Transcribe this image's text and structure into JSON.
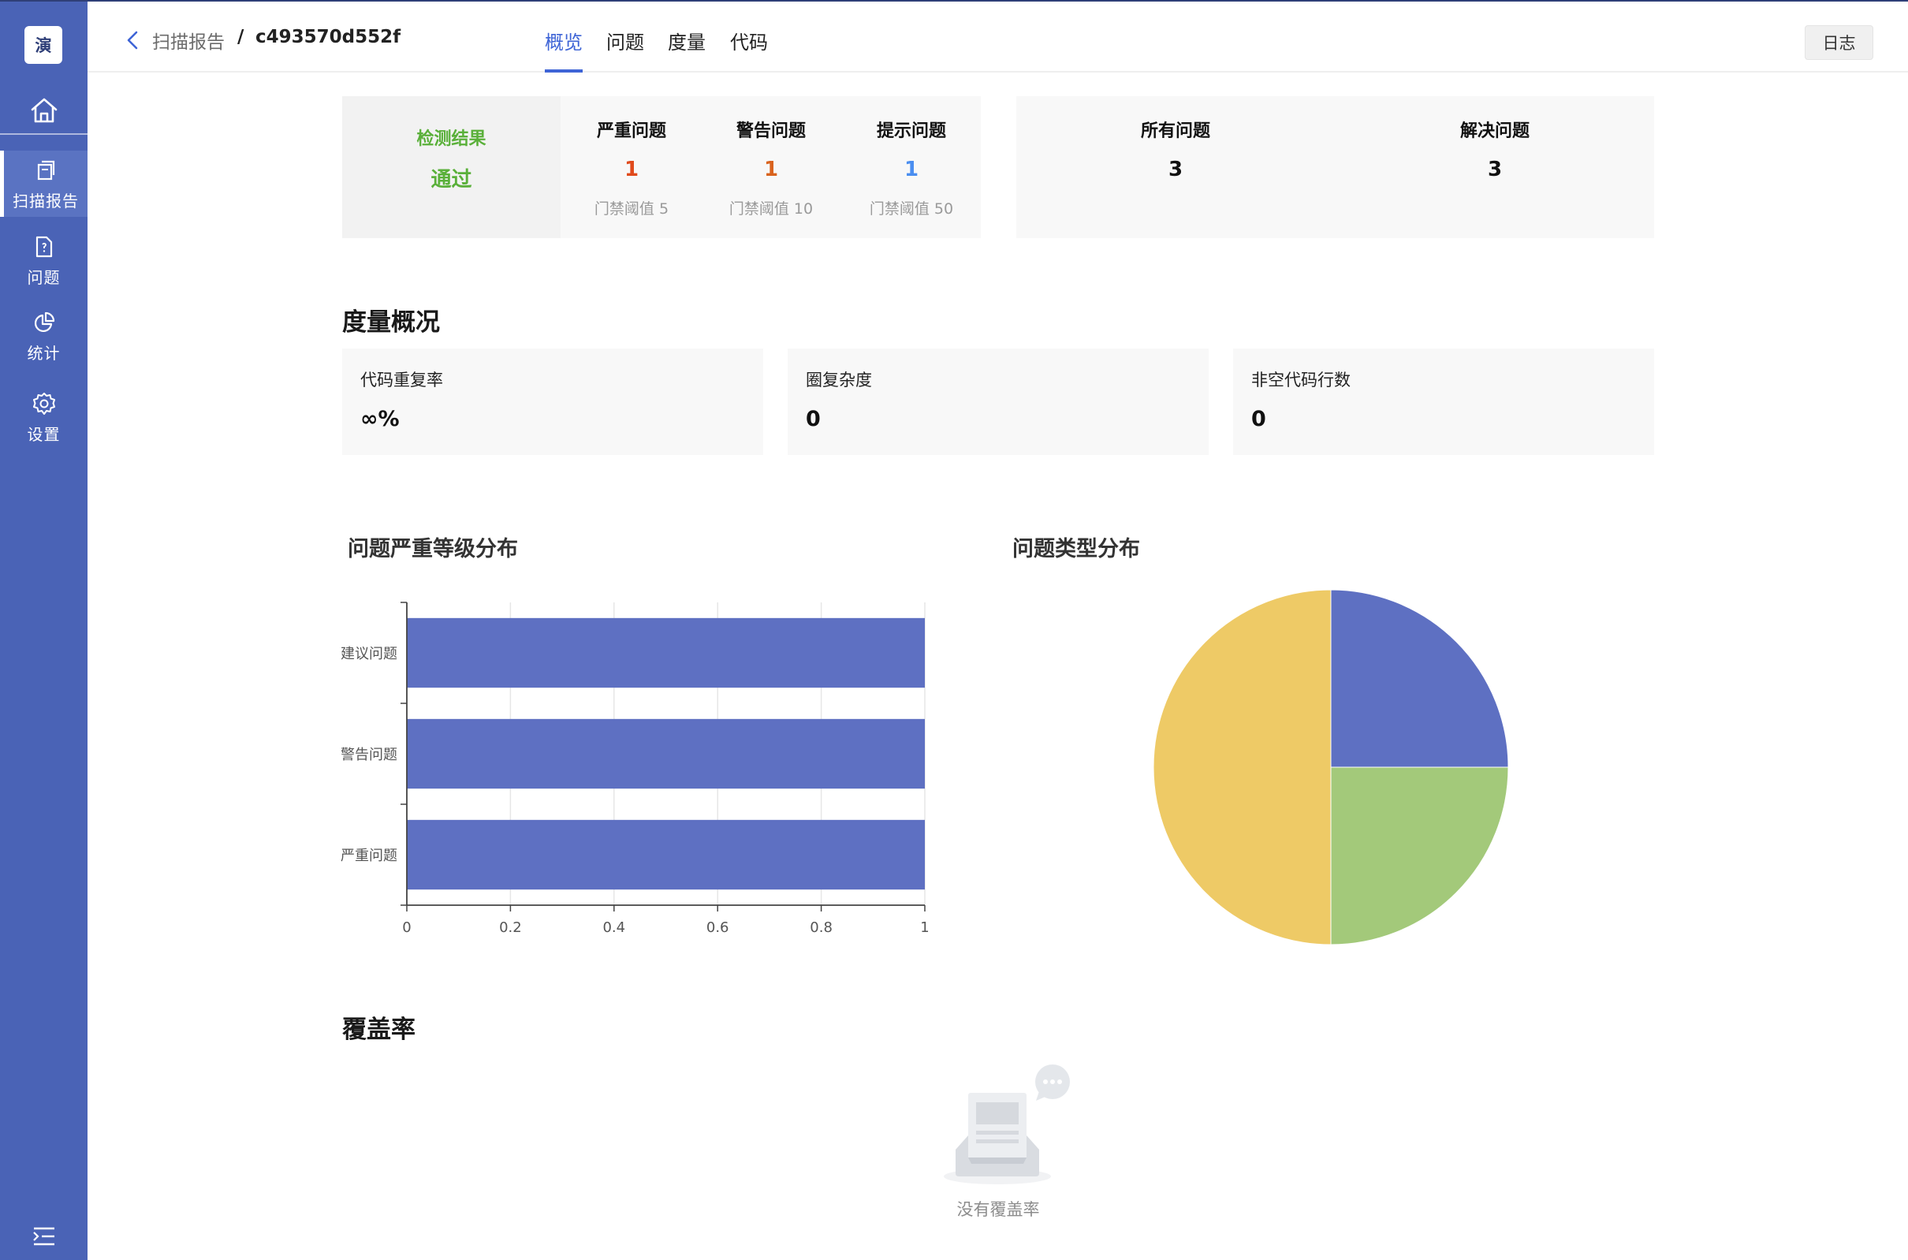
{
  "sidebar": {
    "logo_text": "演",
    "home_icon": "home-icon",
    "items": [
      {
        "label": "扫描报告",
        "icon": "report-icon",
        "active": true
      },
      {
        "label": "问题",
        "icon": "issue-file-icon",
        "active": false
      },
      {
        "label": "统计",
        "icon": "pie-chart-icon",
        "active": false
      },
      {
        "label": "设置",
        "icon": "gear-icon",
        "active": false
      }
    ],
    "collapse_icon": "menu-expand-icon"
  },
  "header": {
    "breadcrumb_root": "扫描报告",
    "breadcrumb_sep": "/",
    "scan_id": "c493570d552f",
    "tabs": [
      {
        "label": "概览",
        "active": true
      },
      {
        "label": "问题",
        "active": false
      },
      {
        "label": "度量",
        "active": false
      },
      {
        "label": "代码",
        "active": false
      }
    ],
    "log_button": "日志"
  },
  "result": {
    "title": "检测结果",
    "value": "通过",
    "severity": [
      {
        "title": "严重问题",
        "count": "1",
        "threshold": "门禁阈值 5",
        "color": "#e04a1c"
      },
      {
        "title": "警告问题",
        "count": "1",
        "threshold": "门禁阈值 10",
        "color": "#d9631e"
      },
      {
        "title": "提示问题",
        "count": "1",
        "threshold": "门禁阈值 50",
        "color": "#4a8ef0"
      }
    ],
    "totals": [
      {
        "title": "所有问题",
        "value": "3"
      },
      {
        "title": "解决问题",
        "value": "3"
      }
    ]
  },
  "metrics": {
    "title": "度量概况",
    "cards": [
      {
        "label": "代码重复率",
        "value": "∞%"
      },
      {
        "label": "圈复杂度",
        "value": "0"
      },
      {
        "label": "非空代码行数",
        "value": "0"
      }
    ]
  },
  "charts": {
    "severity_title": "问题严重等级分布",
    "type_title": "问题类型分布"
  },
  "chart_data": [
    {
      "type": "bar",
      "orientation": "horizontal",
      "title": "问题严重等级分布",
      "categories": [
        "建议问题",
        "警告问题",
        "严重问题"
      ],
      "values": [
        1,
        1,
        1
      ],
      "xlim": [
        0,
        1
      ],
      "xticks": [
        "0",
        "0.2",
        "0.4",
        "0.6",
        "0.8",
        "1"
      ],
      "grid": true,
      "color": "#5e70c2"
    },
    {
      "type": "pie",
      "title": "问题类型分布",
      "slices": [
        {
          "value": 1,
          "color": "#5e70c2"
        },
        {
          "value": 1,
          "color": "#a3c97a"
        },
        {
          "value": 2,
          "color": "#eeca66"
        }
      ]
    }
  ],
  "coverage": {
    "title": "覆盖率",
    "empty_text": "没有覆盖率",
    "empty_icon": "empty-inbox-icon"
  }
}
